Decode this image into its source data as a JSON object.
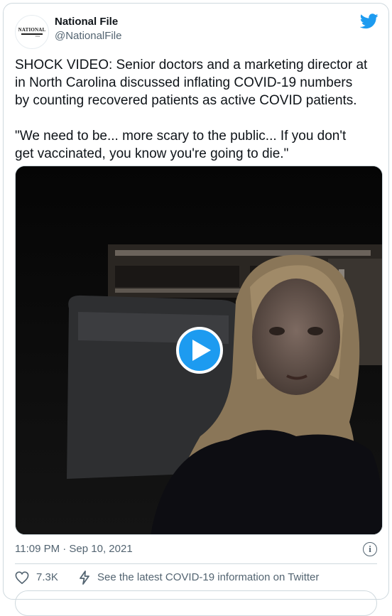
{
  "author": {
    "display_name": "National File",
    "handle": "@NationalFile",
    "avatar_logo_text": "NATIONAL",
    "avatar_logo_sub": "FILE"
  },
  "tweet": {
    "text": "SHOCK VIDEO: Senior doctors and a marketing director at\nin North Carolina discussed inflating COVID-19 numbers\nby counting recovered patients as active COVID patients.\n\n\"We need to be... more scary to the public... If you don't\nget vaccinated, you know you're going to die.\""
  },
  "media": {
    "type": "video",
    "play_icon": "play-icon"
  },
  "meta": {
    "timestamp": "11:09 PM · Sep 10, 2021",
    "info_icon": "info-icon",
    "info_glyph": "i"
  },
  "actions": {
    "like_count": "7.3K",
    "covid_info_label": "See the latest COVID-19 information on Twitter"
  },
  "colors": {
    "brand": "#1d9bf0",
    "text": "#0f1419",
    "secondary_text": "#536471",
    "border": "#cfd9de"
  }
}
